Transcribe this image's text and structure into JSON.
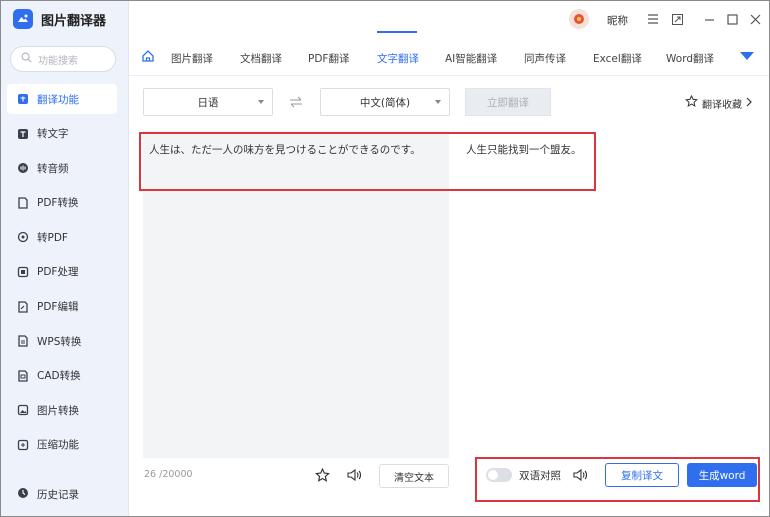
{
  "app": {
    "title": "图片翻译器",
    "user_nick": "昵称"
  },
  "sidebar": {
    "search_placeholder": "功能搜索",
    "items": [
      {
        "label": "翻译功能",
        "icon": "translate-icon",
        "active": true
      },
      {
        "label": "转文字",
        "icon": "text-icon"
      },
      {
        "label": "转音频",
        "icon": "audio-icon"
      },
      {
        "label": "PDF转换",
        "icon": "pdf-convert-icon"
      },
      {
        "label": "转PDF",
        "icon": "to-pdf-icon"
      },
      {
        "label": "PDF处理",
        "icon": "pdf-process-icon"
      },
      {
        "label": "PDF编辑",
        "icon": "pdf-edit-icon"
      },
      {
        "label": "WPS转换",
        "icon": "wps-icon"
      },
      {
        "label": "CAD转换",
        "icon": "cad-icon"
      },
      {
        "label": "图片转换",
        "icon": "image-icon"
      },
      {
        "label": "压缩功能",
        "icon": "compress-icon"
      }
    ],
    "history_label": "历史记录"
  },
  "tabs": [
    "图片翻译",
    "文档翻译",
    "PDF翻译",
    "文字翻译",
    "AI智能翻译",
    "同声传译",
    "Excel翻译",
    "Word翻译"
  ],
  "active_tab": "文字翻译",
  "toolbar": {
    "source_lang": "日语",
    "target_lang": "中文(简体)",
    "translate_button": "立即翻译",
    "favorites_label": "翻译收藏"
  },
  "editor": {
    "source_text": "人生は、ただ一人の味方を見つけることができるのです。",
    "translated_text": "人生只能找到一个盟友。",
    "char_count": "26",
    "char_limit": "/20000",
    "clear_button": "清空文本"
  },
  "result_actions": {
    "bilingual_label": "双语对照",
    "copy_button": "复制译文",
    "generate_button": "生成word"
  },
  "colors": {
    "accent": "#2f6fed",
    "highlight": "#d9363e"
  }
}
